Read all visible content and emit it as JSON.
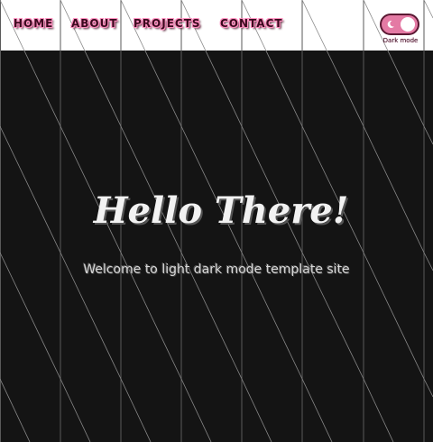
{
  "nav": {
    "links": [
      {
        "label": "HOME"
      },
      {
        "label": "ABOUT"
      },
      {
        "label": "PROJECTS"
      },
      {
        "label": "CONTACT"
      }
    ]
  },
  "theme_toggle": {
    "label": "Dark mode",
    "state": "on",
    "icon": "moon-icon"
  },
  "hero": {
    "title": "Hello There!",
    "subtitle": "Welcome to light dark mode template site"
  },
  "colors": {
    "background_dark": "#141414",
    "navbar_bg": "#ffffff",
    "accent_pink": "#e47aa4",
    "stripe_line": "#6e6e6e",
    "title_text": "#f2f2f2"
  }
}
